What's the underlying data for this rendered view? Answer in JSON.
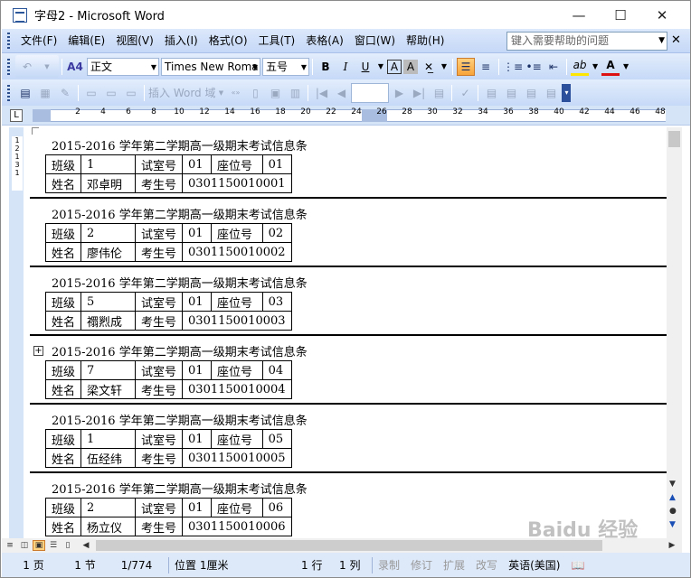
{
  "window": {
    "title": "字母2 - Microsoft Word",
    "minimize": "—",
    "maximize": "☐",
    "close": "✕"
  },
  "menu": {
    "items": [
      "文件(F)",
      "编辑(E)",
      "视图(V)",
      "插入(I)",
      "格式(O)",
      "工具(T)",
      "表格(A)",
      "窗口(W)",
      "帮助(H)"
    ],
    "help_placeholder": "键入需要帮助的问题",
    "close_doc": "✕"
  },
  "format_toolbar": {
    "style_icon": "A4",
    "style": "正文",
    "font": "Times New Roma",
    "size": "五号",
    "bold": "B",
    "italic": "I",
    "underline": "U",
    "char_border": "A",
    "char_shading": "A",
    "font_color": "A",
    "highlight": "ab"
  },
  "mailmerge_toolbar": {
    "insert_word_field": "插入 Word 域"
  },
  "ruler": {
    "numbers": [
      "2",
      "4",
      "6",
      "8",
      "10",
      "12",
      "14",
      "16",
      "18",
      "20",
      "22",
      "24",
      "26",
      "28",
      "30",
      "32",
      "34",
      "36",
      "38",
      "40",
      "42",
      "44",
      "46",
      "48"
    ],
    "corner": "L"
  },
  "vruler": {
    "labels": [
      "1",
      "2",
      "1",
      "3",
      "1"
    ]
  },
  "entries": [
    {
      "title": "2015-2016 学年第二学期高一级期末考试信息条",
      "class_label": "班级",
      "class": "1",
      "room_label": "试室号",
      "room": "01",
      "seat_label": "座位号",
      "seat": "01",
      "name_label": "姓名",
      "name": "邓卓明",
      "exam_label": "考生号",
      "exam_no": "0301150010001"
    },
    {
      "title": "2015-2016 学年第二学期高一级期末考试信息条",
      "class_label": "班级",
      "class": "2",
      "room_label": "试室号",
      "room": "01",
      "seat_label": "座位号",
      "seat": "02",
      "name_label": "姓名",
      "name": "廖伟伦",
      "exam_label": "考生号",
      "exam_no": "0301150010002"
    },
    {
      "title": "2015-2016 学年第二学期高一级期末考试信息条",
      "class_label": "班级",
      "class": "5",
      "room_label": "试室号",
      "room": "01",
      "seat_label": "座位号",
      "seat": "03",
      "name_label": "姓名",
      "name": "禤煭成",
      "exam_label": "考生号",
      "exam_no": "0301150010003"
    },
    {
      "title": "2015-2016 学年第二学期高一级期末考试信息条",
      "class_label": "班级",
      "class": "7",
      "room_label": "试室号",
      "room": "01",
      "seat_label": "座位号",
      "seat": "04",
      "name_label": "姓名",
      "name": "梁文轩",
      "exam_label": "考生号",
      "exam_no": "0301150010004"
    },
    {
      "title": "2015-2016 学年第二学期高一级期末考试信息条",
      "class_label": "班级",
      "class": "1",
      "room_label": "试室号",
      "room": "01",
      "seat_label": "座位号",
      "seat": "05",
      "name_label": "姓名",
      "name": "伍经纬",
      "exam_label": "考生号",
      "exam_no": "0301150010005"
    },
    {
      "title": "2015-2016 学年第二学期高一级期末考试信息条",
      "class_label": "班级",
      "class": "2",
      "room_label": "试室号",
      "room": "01",
      "seat_label": "座位号",
      "seat": "06",
      "name_label": "姓名",
      "name": "杨立仪",
      "exam_label": "考生号",
      "exam_no": "0301150010006"
    }
  ],
  "table_move_handle": "+",
  "status": {
    "page": "1 页",
    "section": "1 节",
    "pages": "1/774",
    "position": "位置 1厘米",
    "line": "1 行",
    "column": "1 列",
    "rec": "录制",
    "trk": "修订",
    "ext": "扩展",
    "ovr": "改写",
    "lang": "英语(美国)"
  },
  "watermark": "Baidu 经验",
  "colors": {
    "menubar": "#c5d8f7",
    "toolbar": "#d6e4f8",
    "accent": "#2b579a"
  }
}
